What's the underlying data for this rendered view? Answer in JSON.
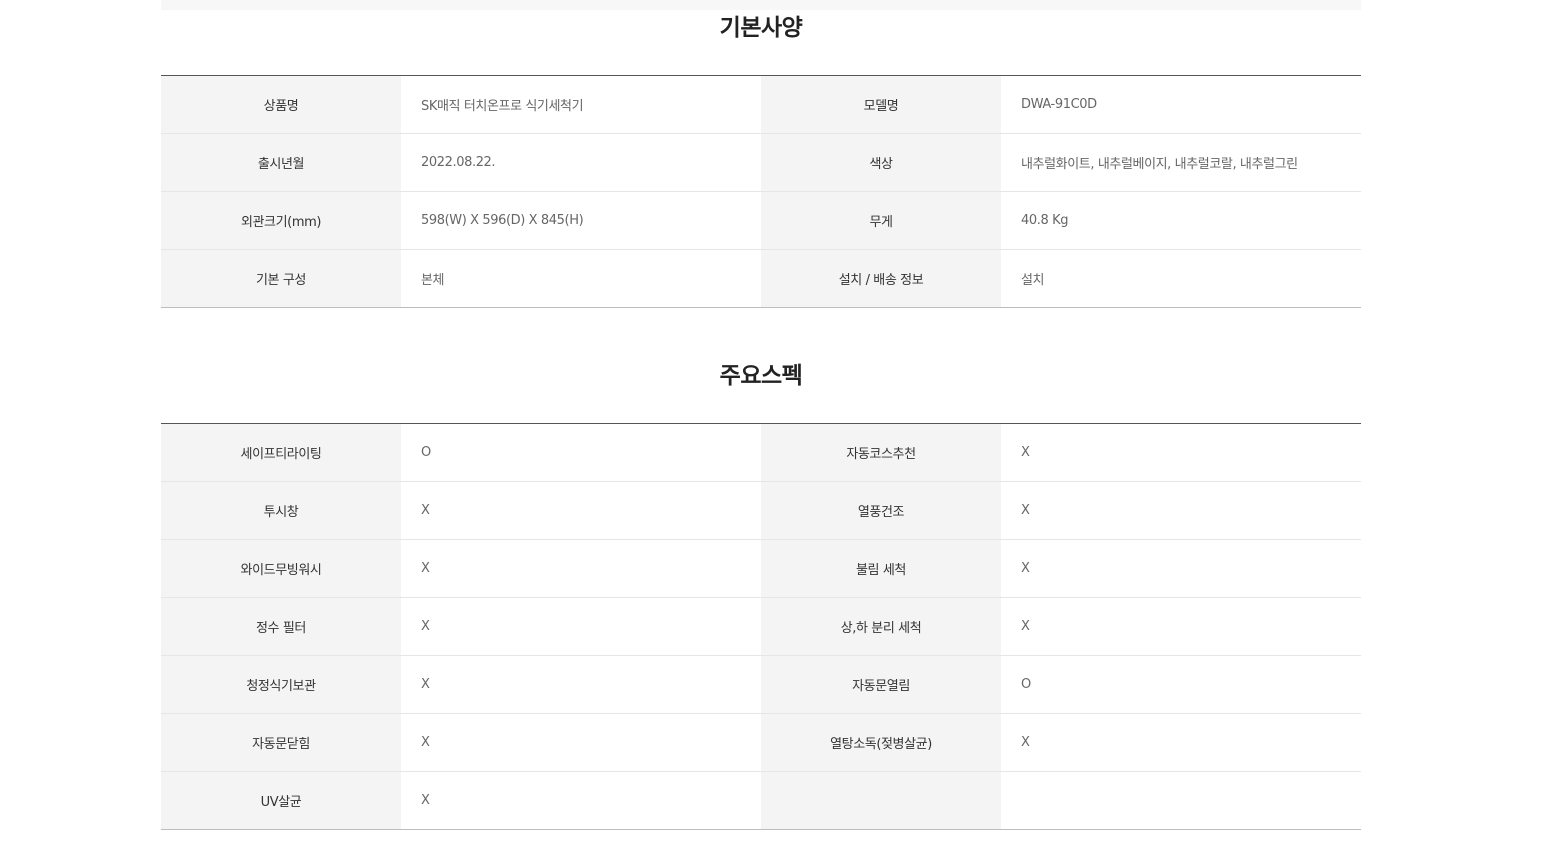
{
  "basic": {
    "title": "기본사양",
    "rows": [
      {
        "l1": "상품명",
        "v1": "SK매직 터치온프로 식기세척기",
        "l2": "모델명",
        "v2": "DWA-91C0D"
      },
      {
        "l1": "출시년월",
        "v1": "2022.08.22.",
        "l2": "색상",
        "v2": "내추럴화이트, 내추럴베이지, 내추럴코랄, 내추럴그린"
      },
      {
        "l1": "외관크기(mm)",
        "v1": "598(W) X 596(D) X 845(H)",
        "l2": "무게",
        "v2": "40.8 Kg"
      },
      {
        "l1": "기본 구성",
        "v1": "본체",
        "l2": "설치 / 배송 정보",
        "v2": "설치"
      }
    ]
  },
  "main": {
    "title": "주요스펙",
    "rows": [
      {
        "l1": "세이프티라이팅",
        "v1": "O",
        "l2": "자동코스추천",
        "v2": "X"
      },
      {
        "l1": "투시창",
        "v1": "X",
        "l2": "열풍건조",
        "v2": "X"
      },
      {
        "l1": "와이드무빙워시",
        "v1": "X",
        "l2": "불림 세척",
        "v2": "X"
      },
      {
        "l1": "정수 필터",
        "v1": "X",
        "l2": "상,하 분리 세척",
        "v2": "X"
      },
      {
        "l1": "청정식기보관",
        "v1": "X",
        "l2": "자동문열림",
        "v2": "O"
      },
      {
        "l1": "자동문닫힘",
        "v1": "X",
        "l2": "열탕소독(젖병살균)",
        "v2": "X"
      },
      {
        "l1": "UV살균",
        "v1": "X",
        "l2": "",
        "v2": ""
      }
    ]
  }
}
